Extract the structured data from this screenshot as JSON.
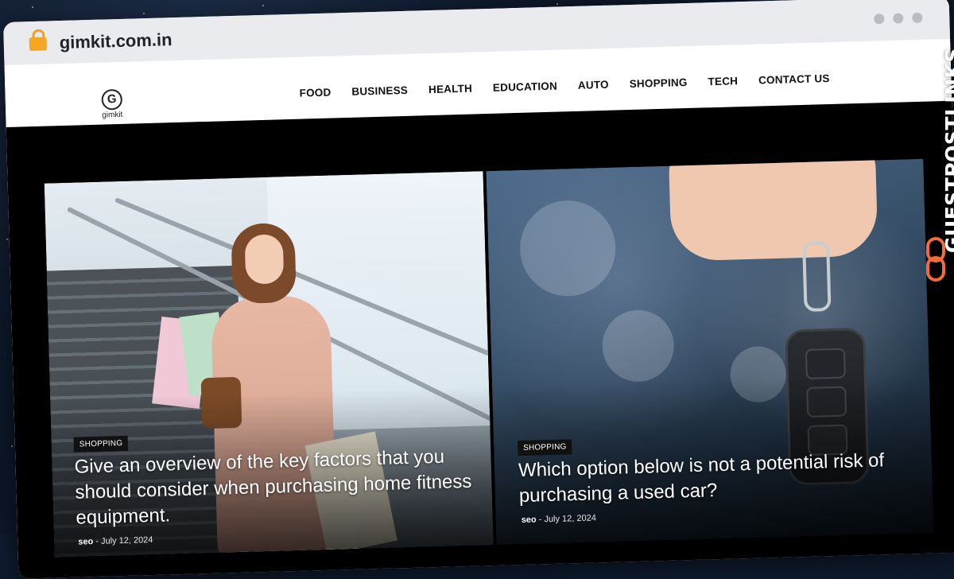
{
  "browser": {
    "url": "gimkit.com.in"
  },
  "site": {
    "logo_mark": "G",
    "logo_text": "gimkit",
    "nav": [
      "FOOD",
      "BUSINESS",
      "HEALTH",
      "EDUCATION",
      "AUTO",
      "SHOPPING",
      "TECH",
      "CONTACT US"
    ]
  },
  "posts": [
    {
      "category": "SHOPPING",
      "title": "Give an overview of the key factors that you should consider when purchasing home fitness equipment.",
      "author": "seo",
      "separator": "-",
      "date": "July 12, 2024"
    },
    {
      "category": "SHOPPING",
      "title": "Which option below is not a potential risk of purchasing a used car?",
      "author": "seo",
      "separator": "-",
      "date": "July 12, 2024"
    }
  ],
  "watermark": {
    "text": "GUESTPOSTLINKS",
    "icon": "chain-link-icon",
    "accent": "#f26b3a"
  },
  "colors": {
    "page_bg": "#0c1728",
    "hero_bg": "#000000",
    "lock": "#f5a623"
  }
}
